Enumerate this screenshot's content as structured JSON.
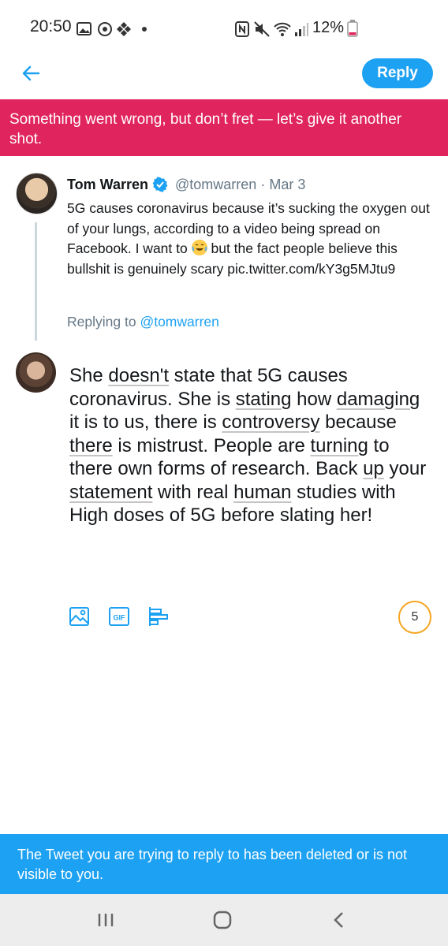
{
  "status_bar": {
    "time": "20:50",
    "battery": "12%"
  },
  "header": {
    "back_icon": "arrow-left-icon",
    "reply_label": "Reply"
  },
  "error_banner": {
    "text": "Something went wrong, but don’t fret — let’s give it another shot."
  },
  "quoted_tweet": {
    "author": "Tom Warren",
    "handle": "@tomwarren",
    "separator": "·",
    "date": "Mar 3",
    "text_before_emoji": "5G causes coronavirus because it’s sucking the oxygen out of your lungs, according to a video being spread on Facebook. I want to",
    "emoji": "face-with-tears-of-joy",
    "text_after_emoji": "but the fact people believe this bullshit is genuinely scary pic.twitter.com/kY3g5MJtu9",
    "replying_prefix": "Replying to",
    "replying_to": "@tomwarren"
  },
  "composer": {
    "tokens": [
      {
        "t": "She ",
        "u": false
      },
      {
        "t": "doesn't",
        "u": true
      },
      {
        "t": " state that 5G causes coronavirus. She is ",
        "u": false
      },
      {
        "t": "stating",
        "u": true
      },
      {
        "t": " how ",
        "u": false
      },
      {
        "t": "damaging",
        "u": true
      },
      {
        "t": " it is to us, there is ",
        "u": false
      },
      {
        "t": "controversy",
        "u": true
      },
      {
        "t": " because ",
        "u": false
      },
      {
        "t": "there",
        "u": true
      },
      {
        "t": " is mistrust. People are ",
        "u": false
      },
      {
        "t": "turning",
        "u": true
      },
      {
        "t": " to there own forms of research. Back ",
        "u": false
      },
      {
        "t": "up",
        "u": true
      },
      {
        "t": " your ",
        "u": false
      },
      {
        "t": "statement",
        "u": true
      },
      {
        "t": " with real ",
        "u": false
      },
      {
        "t": "human",
        "u": true
      },
      {
        "t": " studies with High doses of 5G before slating her!",
        "u": false
      }
    ],
    "toolbar": [
      "image-icon",
      "gif-icon",
      "poll-icon"
    ],
    "chars_remaining": "5"
  },
  "notice": {
    "text": "The Tweet you are trying to reply to has been deleted or is not visible to you."
  },
  "nav": {
    "recents_icon": "recents-icon",
    "home_icon": "home-icon",
    "back_icon": "back-chevron-icon"
  },
  "colors": {
    "accent": "#1da1f2",
    "error": "#e0245e",
    "counter_warning": "#f5a623"
  }
}
